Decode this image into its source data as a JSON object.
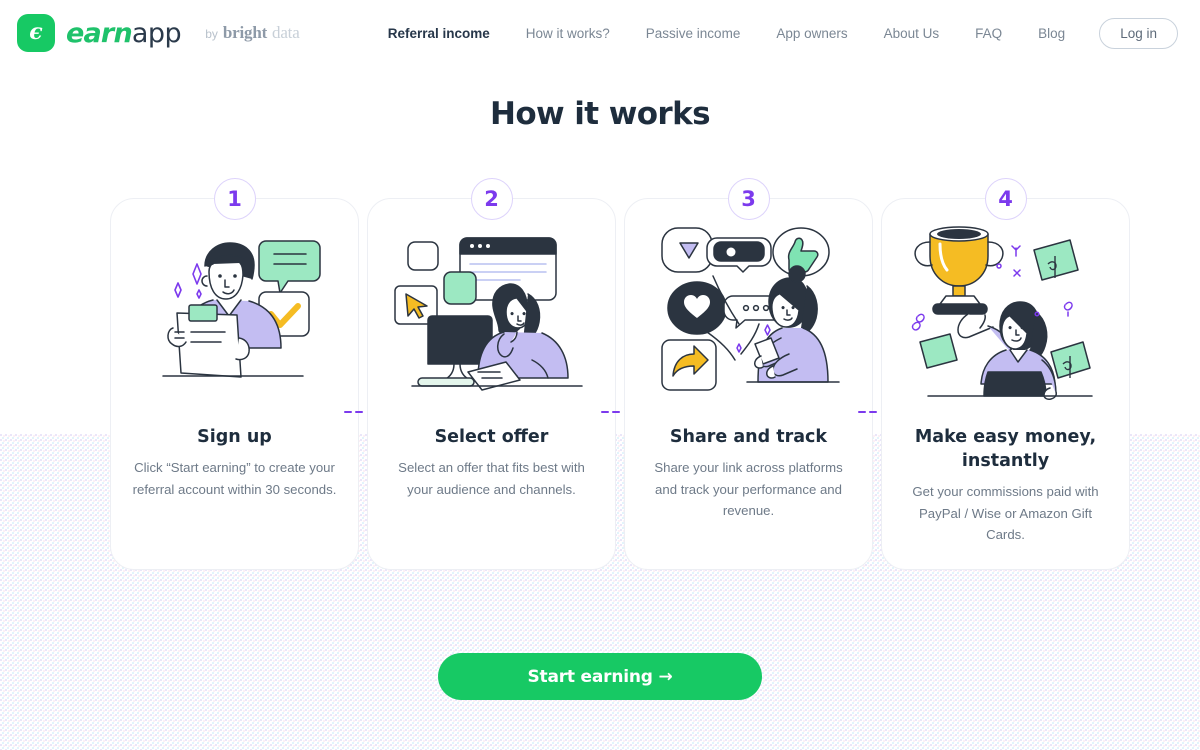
{
  "brand": {
    "logo_icon": "earnapp-e-logo-icon",
    "word_earn": "earn",
    "word_app": "app",
    "by": "by",
    "partner_bold": "bright",
    "partner_light": "data",
    "green": "#17c964",
    "purple": "#7c3aed"
  },
  "nav": {
    "links": [
      {
        "label": "Referral income",
        "active": true
      },
      {
        "label": "How it works?",
        "active": false
      },
      {
        "label": "Passive income",
        "active": false
      },
      {
        "label": "App owners",
        "active": false
      },
      {
        "label": "About Us",
        "active": false
      },
      {
        "label": "FAQ",
        "active": false
      },
      {
        "label": "Blog",
        "active": false
      }
    ],
    "login_label": "Log in"
  },
  "heading": "How it works",
  "connector_icon": "dashed-arrow-right-icon",
  "steps": [
    {
      "number": "1",
      "illustration": "person-reading-document-illustration",
      "title": "Sign up",
      "body": "Click “Start earning” to create your referral account within 30 seconds."
    },
    {
      "number": "2",
      "illustration": "person-at-desktop-computer-illustration",
      "title": "Select offer",
      "body": "Select an offer that fits best with your audience and channels."
    },
    {
      "number": "3",
      "illustration": "person-sharing-on-phone-illustration",
      "title": "Share and track",
      "body": "Share your link across platforms and track your performance and revenue."
    },
    {
      "number": "4",
      "illustration": "person-holding-trophy-with-money-illustration",
      "title": "Make easy money, instantly",
      "body": "Get your commissions paid with PayPal / Wise or Amazon Gift Cards."
    }
  ],
  "cta": {
    "label": "Start earning  →"
  }
}
